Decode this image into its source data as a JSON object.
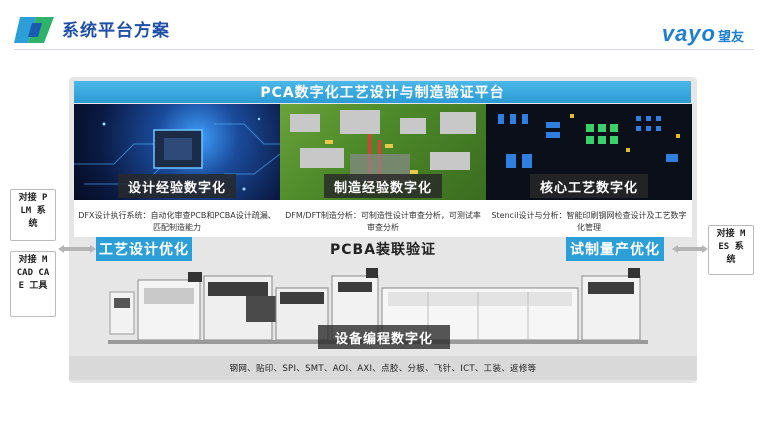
{
  "header": {
    "title": "系统平台方案"
  },
  "brand": {
    "name_en": "vayo",
    "name_cn": "望友"
  },
  "platform": {
    "title": "PCA数字化工艺设计与制造验证平台"
  },
  "cards": [
    {
      "label": "设计经验数字化",
      "desc": "DFX设计执行系统：自动化审查PCB和PCBA设计疏漏、匹配制造能力"
    },
    {
      "label": "制造经验数字化",
      "desc": "DFM/DFT制造分析：可制造性设计审查分析，可测试率审查分析"
    },
    {
      "label": "核心工艺数字化",
      "desc": "Stencil设计与分析：智能印刷钢网检查设计及工艺数字化管理"
    }
  ],
  "left_boxes": [
    {
      "text": "对接 PLM 系统"
    },
    {
      "text": "对接 MCAD CAE 工具"
    }
  ],
  "right_box": {
    "text": "对接 MES 系统"
  },
  "process": {
    "left": "工艺设计优化",
    "center": "PCBA装联验证",
    "right": "试制量产优化"
  },
  "device": {
    "label": "设备编程数字化"
  },
  "footer": {
    "text": "钢网、贴印、SPI、SMT、AOI、AXI、点胶、分板、飞针、ICT、工装、返修等"
  },
  "colors": {
    "accent": "#2d9fd8",
    "title": "#1f4fa8"
  }
}
